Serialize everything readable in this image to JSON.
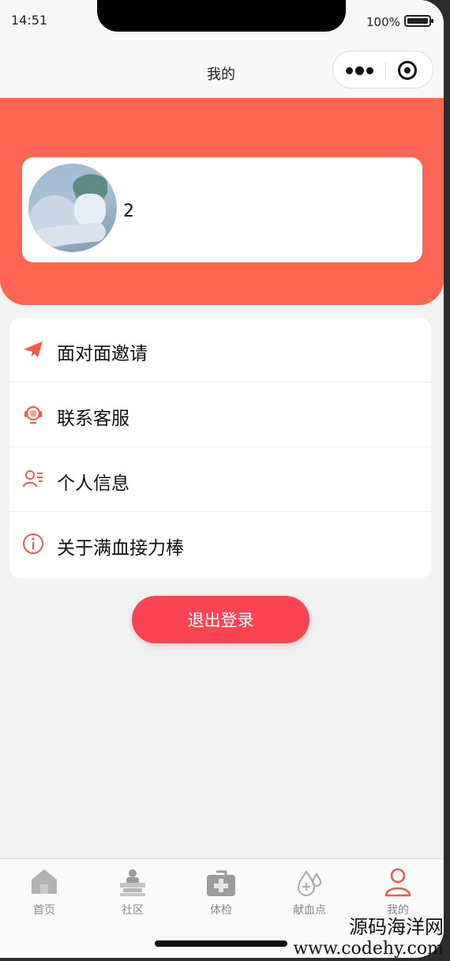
{
  "status_bar": {
    "time": "14:51",
    "battery": "100%"
  },
  "nav": {
    "title": "我的"
  },
  "profile": {
    "name": "2"
  },
  "menu": [
    {
      "label": "面对面邀请",
      "icon": "paper-plane-icon"
    },
    {
      "label": "联系客服",
      "icon": "headset-icon"
    },
    {
      "label": "个人信息",
      "icon": "user-info-icon"
    },
    {
      "label": "关于满血接力棒",
      "icon": "info-icon"
    }
  ],
  "logout_label": "退出登录",
  "tabs": [
    {
      "label": "首页",
      "icon": "home-icon"
    },
    {
      "label": "社区",
      "icon": "community-icon"
    },
    {
      "label": "体检",
      "icon": "medical-kit-icon"
    },
    {
      "label": "献血点",
      "icon": "blood-drop-icon"
    },
    {
      "label": "我的",
      "icon": "profile-icon",
      "active": true
    }
  ],
  "colors": {
    "accent": "#fe6552",
    "button": "#fd4455",
    "tab_inactive": "#888888"
  },
  "watermark": {
    "line1": "源码海洋网",
    "line2": "www.codehy.com"
  }
}
